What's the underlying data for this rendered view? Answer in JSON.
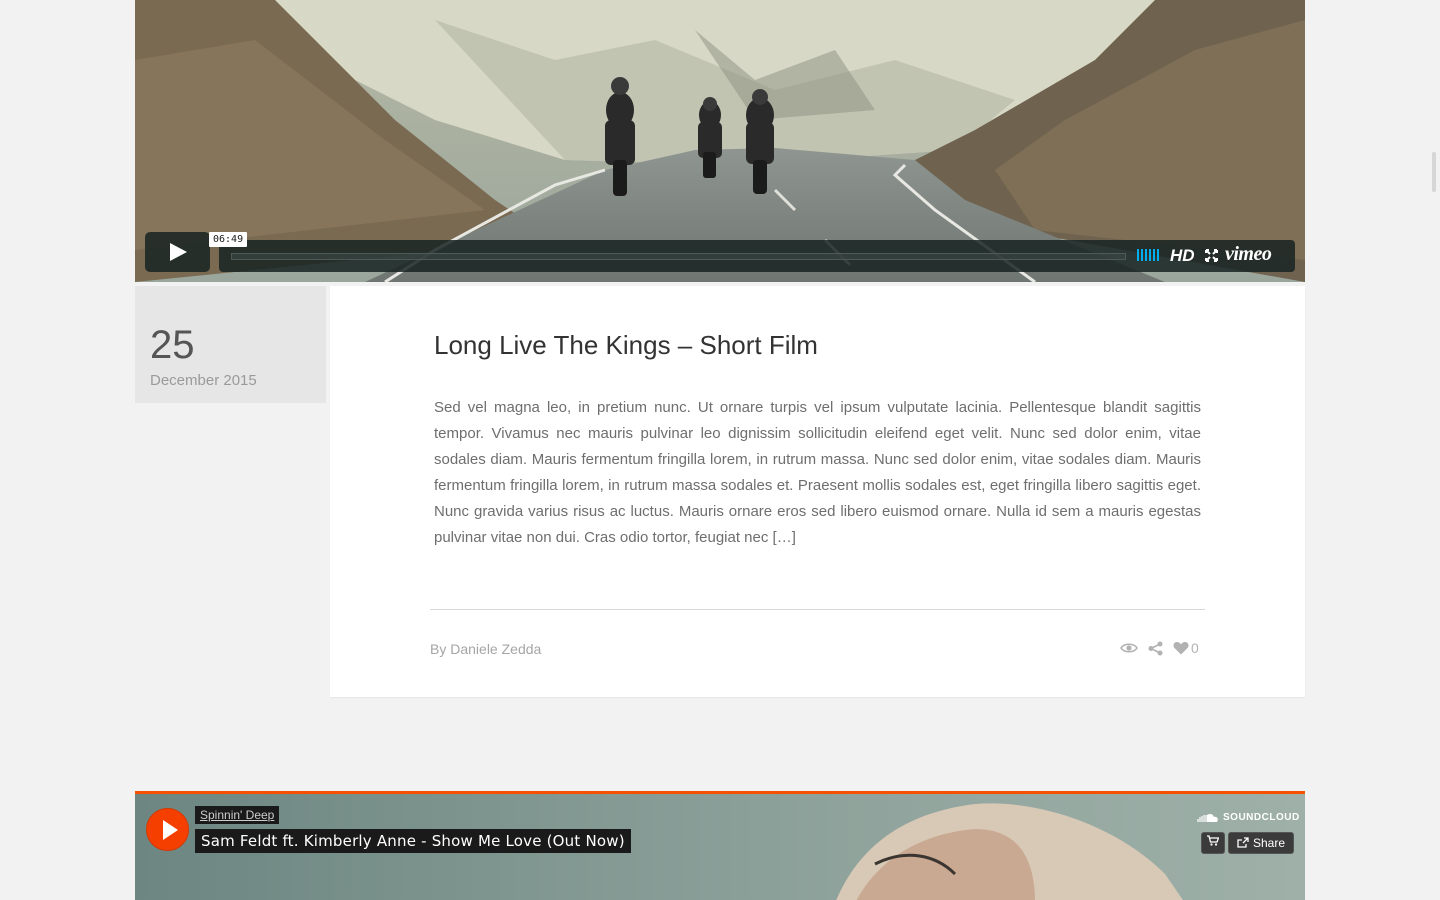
{
  "video": {
    "time_tooltip": "06:49",
    "hd_label": "HD",
    "brand_logo": "vimeo",
    "icons": [
      "play-icon",
      "volume-icon",
      "fullscreen-icon"
    ]
  },
  "post": {
    "date": {
      "day": "25",
      "month_year": "December 2015"
    },
    "title": "Long Live The Kings – Short Film",
    "excerpt": "Sed vel magna leo, in pretium nunc. Ut ornare turpis vel ipsum vulputate lacinia. Pellentesque blandit sagittis tempor. Vivamus nec mauris pulvinar leo dignissim sollicitudin eleifend eget velit. Nunc sed dolor enim, vitae sodales diam. Mauris fermentum fringilla lorem, in rutrum massa. Nunc sed dolor enim, vitae sodales diam. Mauris fermentum fringilla lorem, in rutrum massa sodales et. Praesent mollis sodales est, eget fringilla libero sagittis eget. Nunc gravida varius risus ac luctus. Mauris ornare eros sed libero euismod ornare. Nulla id sem a mauris egestas pulvinar vitae non dui. Cras odio tortor, feugiat nec […]",
    "author_prefix": "By",
    "author_name": "Daniele Zedda",
    "like_count": "0",
    "meta_icons": [
      "eye-icon",
      "share-icon",
      "heart-icon"
    ]
  },
  "soundcloud": {
    "user": "Spinnin' Deep",
    "track": "Sam Feldt ft. Kimberly Anne - Show Me Love (Out Now)",
    "logo_text": "SOUNDCLOUD",
    "share_label": "Share",
    "accent": "#f65100"
  },
  "colors": {
    "page_bg": "#f2f2f2",
    "card_bg": "#ffffff",
    "date_bg": "#e6e6e6",
    "vimeo_blue": "#00adef"
  }
}
